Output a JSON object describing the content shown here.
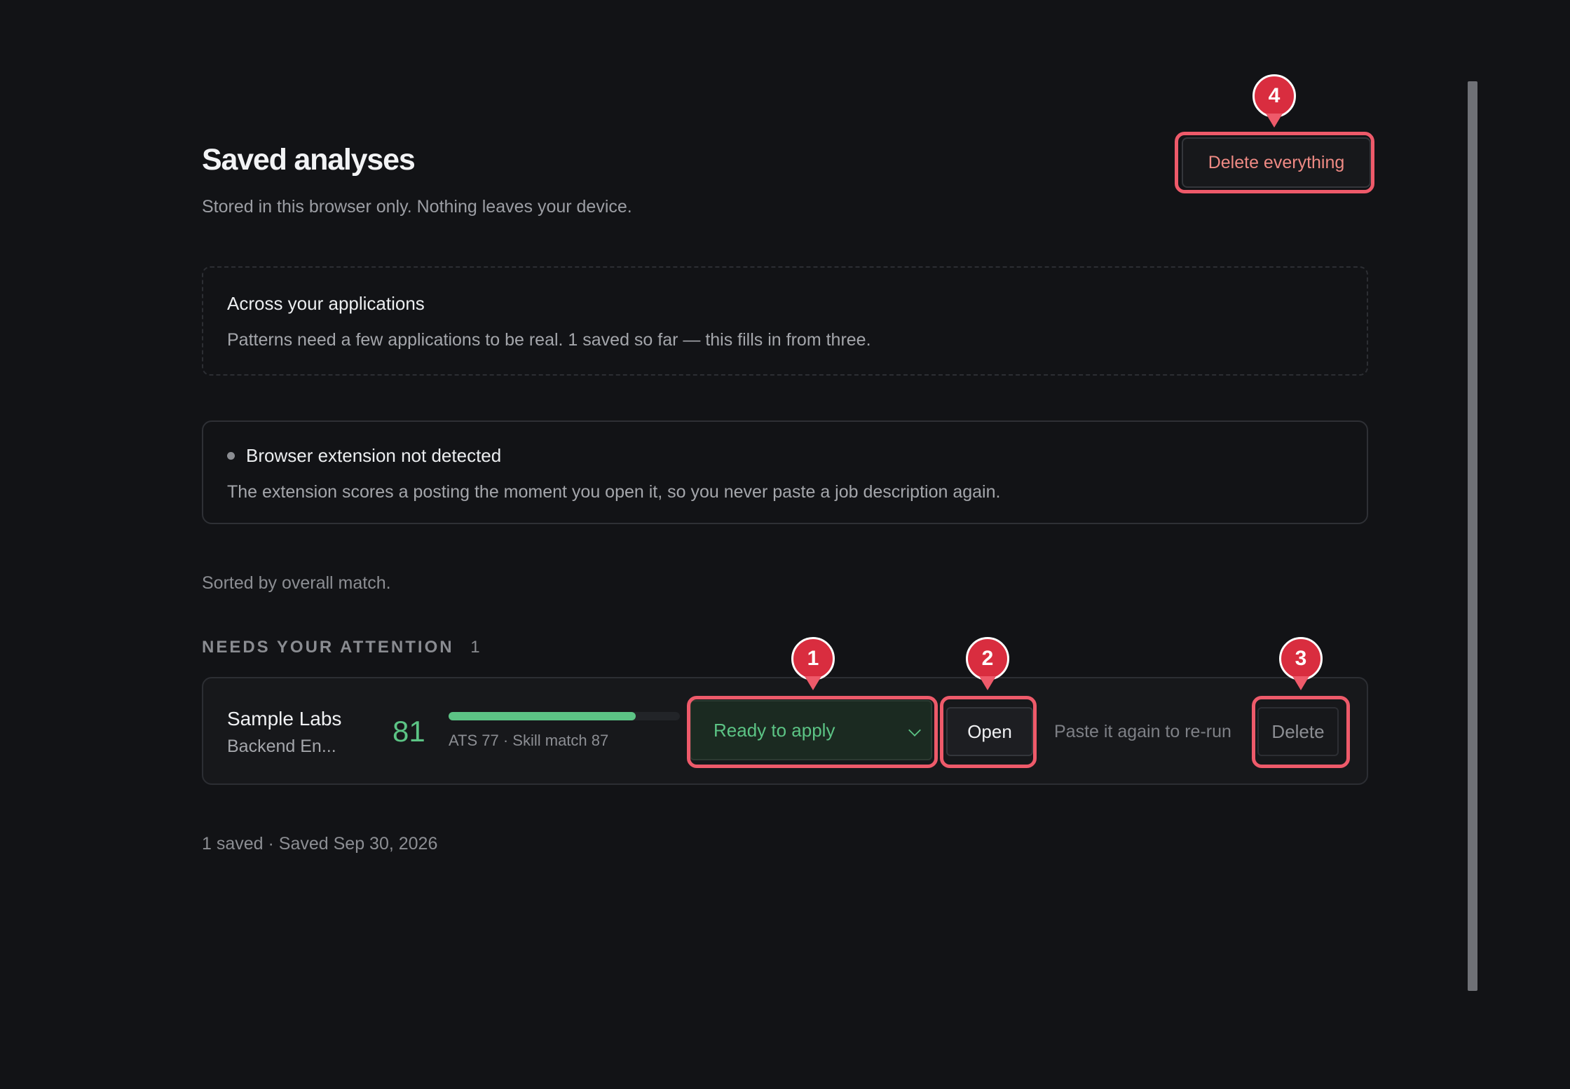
{
  "header": {
    "title": "Saved analyses",
    "subtitle": "Stored in this browser only. Nothing leaves your device.",
    "delete_all_label": "Delete everything"
  },
  "insights_card": {
    "title": "Across your applications",
    "body": "Patterns need a few applications to be real. 1 saved so far — this fills in from three."
  },
  "extension_card": {
    "title": "Browser extension not detected",
    "body": "The extension scores a posting the moment you open it, so you never paste a job description again."
  },
  "sort_note": "Sorted by overall match.",
  "section": {
    "heading": "NEEDS YOUR ATTENTION",
    "count": "1"
  },
  "rows": [
    {
      "company": "Sample Labs",
      "role": "Backend En...",
      "score": "81",
      "match_fraction": 0.81,
      "breakdown": "ATS 77 · Skill match 87",
      "status": "Ready to apply",
      "open_label": "Open",
      "rerun_note": "Paste it again to re-run",
      "delete_label": "Delete"
    }
  ],
  "footer": "1 saved · Saved Sep 30, 2026",
  "annotations": [
    "1",
    "2",
    "3",
    "4"
  ],
  "colors": {
    "background": "#121316",
    "accent_green": "#5cc485",
    "danger_text": "#ef8a84",
    "annotation_red": "#ee5a6a"
  }
}
